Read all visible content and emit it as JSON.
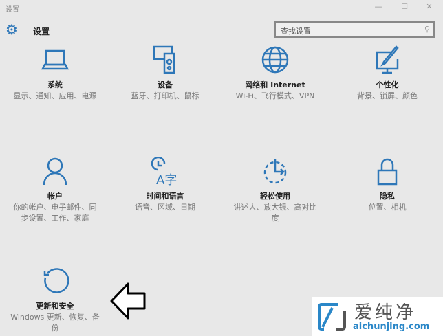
{
  "window": {
    "title": "设置",
    "controls": [
      "—",
      "☐",
      "✕"
    ]
  },
  "header": {
    "title": "设置",
    "search_placeholder": "查找设置"
  },
  "tiles": [
    {
      "title": "系统",
      "desc": "显示、通知、应用、电源",
      "icon": "laptop-icon"
    },
    {
      "title": "设备",
      "desc": "蓝牙、打印机、鼠标",
      "icon": "devices-icon"
    },
    {
      "title": "网络和 Internet",
      "desc": "Wi-Fi、飞行模式、VPN",
      "icon": "globe-icon"
    },
    {
      "title": "个性化",
      "desc": "背景、锁屏、颜色",
      "icon": "personalize-icon"
    },
    {
      "title": "帐户",
      "desc": "你的帐户、电子邮件、同步设置、工作、家庭",
      "icon": "person-icon"
    },
    {
      "title": "时间和语言",
      "desc": "语音、区域、日期",
      "icon": "time-language-icon"
    },
    {
      "title": "轻松使用",
      "desc": "讲述人、放大镜、高对比度",
      "icon": "ease-of-access-icon"
    },
    {
      "title": "隐私",
      "desc": "位置、相机",
      "icon": "lock-icon"
    },
    {
      "title": "更新和安全",
      "desc": "Windows 更新、恢复、备份",
      "icon": "update-icon"
    }
  ],
  "watermark": {
    "cn": "爱纯净",
    "en": "aichunjing.com"
  },
  "colors": {
    "accent": "#2e77b8",
    "bg": "#e8e8e8"
  }
}
